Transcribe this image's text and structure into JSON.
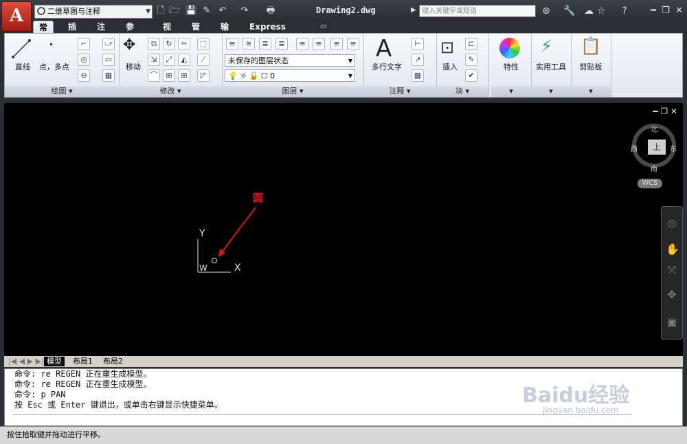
{
  "app": {
    "icon_letter": "A"
  },
  "workspace": {
    "label": "二维草图与注释"
  },
  "document": {
    "title": "Drawing2.dwg"
  },
  "search": {
    "placeholder": "键入关键字或短语"
  },
  "tabs": [
    {
      "label": "常用"
    },
    {
      "label": "插入"
    },
    {
      "label": "注释"
    },
    {
      "label": "参数化"
    },
    {
      "label": "视图"
    },
    {
      "label": "管理"
    },
    {
      "label": "输出"
    },
    {
      "label": "Express Tools"
    }
  ],
  "ribbon": {
    "draw": {
      "title": "绘图",
      "line_label": "直线",
      "polyline_label": "点，多点"
    },
    "modify": {
      "title": "修改",
      "move_label": "移动"
    },
    "layers": {
      "title": "图层",
      "state_value": "未保存的图层状态",
      "layer_value": "0"
    },
    "annotation": {
      "title": "注释",
      "mtext_label": "多行文字",
      "big_icon": "A"
    },
    "block": {
      "title": "块",
      "insert_label": "插入"
    },
    "properties": {
      "title": "特性"
    },
    "utilities": {
      "title": "实用工具"
    },
    "clipboard": {
      "title": "剪贴板"
    }
  },
  "viewcube": {
    "north": "北",
    "south": "南",
    "east": "东",
    "west": "西",
    "face": "上",
    "wcs": "WCS"
  },
  "drawing": {
    "annotation_text": "圆",
    "axis_y": "Y",
    "axis_x": "X",
    "axis_w": "W"
  },
  "layout_tabs": [
    {
      "label": "模型"
    },
    {
      "label": "布局1"
    },
    {
      "label": "布局2"
    }
  ],
  "command_lines": [
    "命令: re REGEN 正在重生成模型。",
    "命令: re REGEN 正在重生成模型。",
    "命令: p PAN",
    "按 Esc 或 Enter 键退出，或单击右键显示快捷菜单。"
  ],
  "status": {
    "text": "按住拾取键并拖动进行平移。"
  },
  "watermark": {
    "text": "Baidu经验",
    "url": "jingyan.baidu.com"
  },
  "colors": {
    "annotation": "#e0101a",
    "canvas": "#000000"
  }
}
